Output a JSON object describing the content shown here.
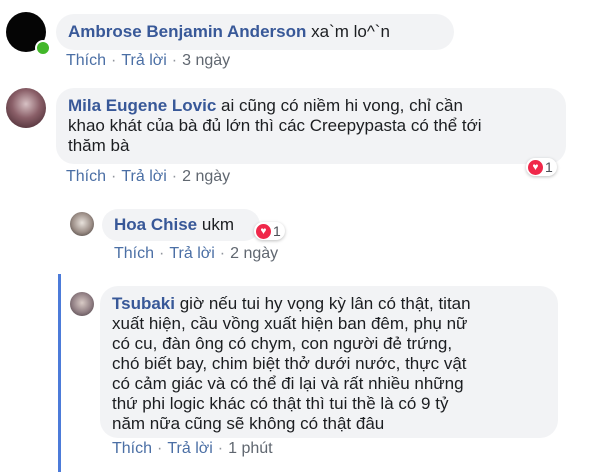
{
  "comments": [
    {
      "author": "Ambrose Benjamin Anderson",
      "text": "xa`m lo^`n",
      "like": "Thích",
      "reply": "Trả lời",
      "time": "3 ngày"
    },
    {
      "author": "Mila Eugene Lovic",
      "text_line1": "ai cũng có niềm hi vong, chỉ cần",
      "text_line2": "khao khát của bà đủ lớn thì các Creepypasta có thể tới",
      "text_line3": "thăm bà",
      "reactions": "1",
      "like": "Thích",
      "reply": "Trả lời",
      "time": "2 ngày"
    },
    {
      "author": "Hoa Chise",
      "text": "ukm",
      "reactions": "1",
      "like": "Thích",
      "reply": "Trả lời",
      "time": "2 ngày"
    },
    {
      "author": "Tsubaki",
      "line1": "giờ nếu tui hy vọng kỳ lân có thật, titan",
      "line2": "xuất hiện, cầu vồng xuất hiện ban đêm, phụ nữ",
      "line3": "có cu, đàn ông có chym, con người đẻ trứng,",
      "line4": "chó biết bay, chim biệt thở dưới nước, thực vật",
      "line5": "có cảm giác và có thể đi lại và rất nhiều những",
      "line6": "thứ phi logic khác có thật thì tui thề là có 9 tỷ",
      "line7": "năm nữa cũng sẽ không có thật đâu",
      "like": "Thích",
      "reply": "Trả lời",
      "time": "1 phút"
    }
  ],
  "colors": {
    "name": "#385898",
    "link": "#4b6fa5",
    "bubble": "#f2f3f5",
    "heart": "#f0284a",
    "thread": "#4c7bd9",
    "online": "#42b72a"
  }
}
